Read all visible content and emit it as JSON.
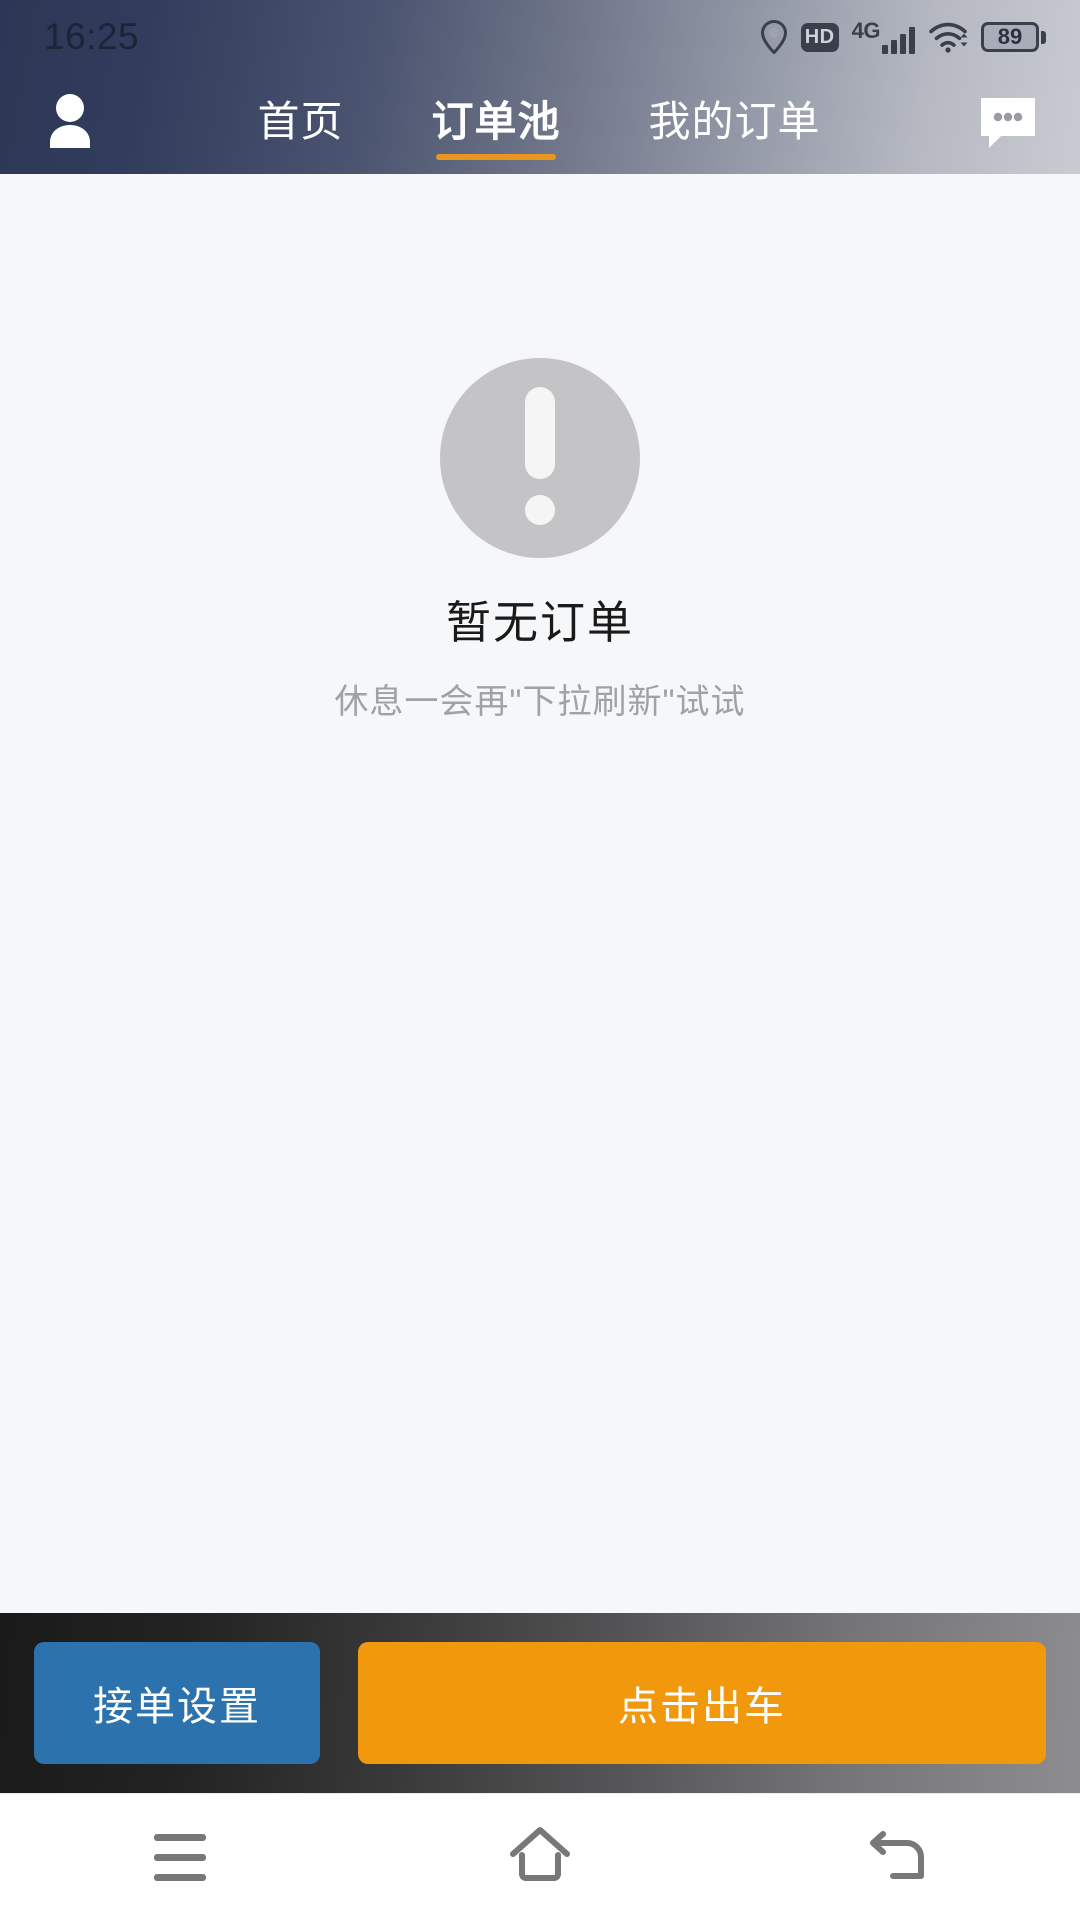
{
  "statusbar": {
    "time": "16:25",
    "icons": {
      "location": "location-pin-icon",
      "hd": "HD",
      "network_type": "4G",
      "wifi": "wifi-icon",
      "battery_level": "89"
    }
  },
  "header": {
    "profile_icon": "person-icon",
    "chat_icon": "chat-bubble-icon",
    "accent_color": "#e8961e",
    "tabs": [
      {
        "label": "首页",
        "active": false
      },
      {
        "label": "订单池",
        "active": true
      },
      {
        "label": "我的订单",
        "active": false
      }
    ]
  },
  "main": {
    "empty_state": {
      "icon": "exclamation-circle-icon",
      "title": "暂无订单",
      "subtitle": "休息一会再\"下拉刷新\"试试"
    }
  },
  "actionbar": {
    "secondary_button": {
      "label": "接单设置",
      "color": "#2c73ad"
    },
    "primary_button": {
      "label": "点击出车",
      "color": "#f2980c"
    }
  },
  "system_nav": {
    "menu": "menu-icon",
    "home": "home-icon",
    "back": "back-icon"
  }
}
